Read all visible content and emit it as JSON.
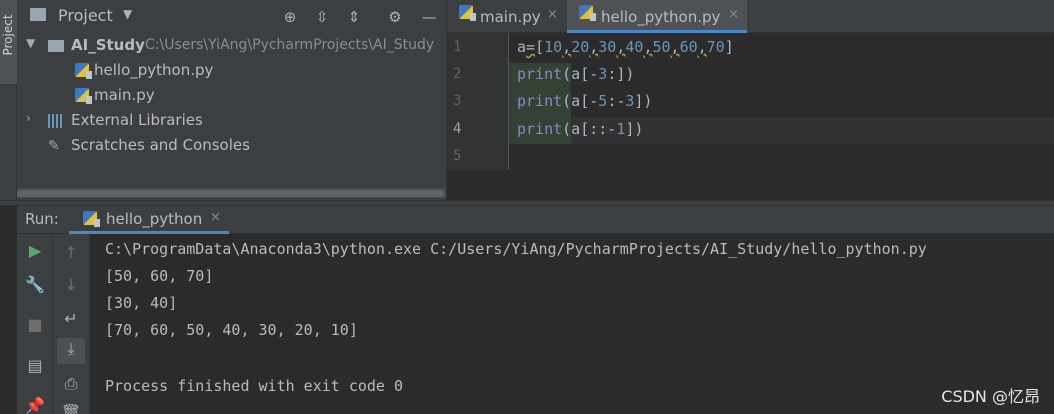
{
  "toolstrip": {
    "label": "Project"
  },
  "project": {
    "title": "Project",
    "tree": [
      {
        "label": "AI_Study",
        "path": "C:\\Users\\YiAng\\PycharmProjects\\AI_Study"
      },
      {
        "label": "hello_python.py"
      },
      {
        "label": "main.py"
      },
      {
        "label": "External Libraries"
      },
      {
        "label": "Scratches and Consoles"
      }
    ]
  },
  "editor": {
    "tabs": [
      {
        "label": "main.py",
        "close": "×"
      },
      {
        "label": "hello_python.py",
        "close": "×"
      }
    ],
    "line_numbers": [
      "1",
      "2",
      "3",
      "4",
      "5"
    ]
  },
  "run": {
    "label": "Run:",
    "tab_label": "hello_python",
    "tab_close": "×",
    "console": [
      "C:\\ProgramData\\Anaconda3\\python.exe C:/Users/YiAng/PycharmProjects/AI_Study/hello_python.py",
      "[50, 60, 70]",
      "[30, 40]",
      "[70, 60, 50, 40, 30, 20, 10]",
      "",
      "Process finished with exit code 0"
    ],
    "watermark": "CSDN @忆昂"
  },
  "colors": {
    "accent": "#4a88c7",
    "keyword": "#8888c6",
    "number": "#6897bb",
    "run_green": "#59a869"
  }
}
